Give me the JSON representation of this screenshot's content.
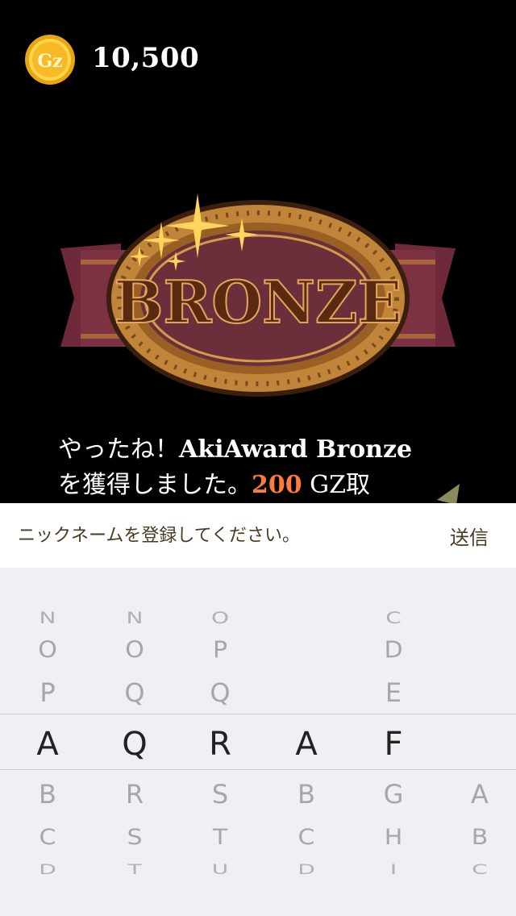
{
  "header": {
    "coin_label": "Gz",
    "coin_count": "10,500"
  },
  "badge": {
    "label": "BRONZE"
  },
  "message": {
    "part1": "やったね！",
    "award": "AkiAward Bronze",
    "part2": "を獲得しました。",
    "amount": "200",
    "unit": "GZ取"
  },
  "input": {
    "placeholder": "ニックネームを登録してください。",
    "value": "",
    "send_label": "送信"
  },
  "picker": {
    "columns": [
      [
        "N",
        "O",
        "P",
        "A",
        "B",
        "C",
        "D"
      ],
      [
        "N",
        "O",
        "Q",
        "R",
        "S",
        "T"
      ],
      [
        "O",
        "P",
        "Q",
        "R",
        "S",
        "T",
        "U"
      ],
      [
        "A",
        "B",
        "C",
        "D"
      ],
      [
        "C",
        "D",
        "E",
        "F",
        "G",
        "H",
        "I"
      ],
      [
        "A",
        "B",
        "C"
      ]
    ],
    "selected": [
      "A",
      "Q",
      "R",
      "A",
      "F",
      ""
    ]
  }
}
